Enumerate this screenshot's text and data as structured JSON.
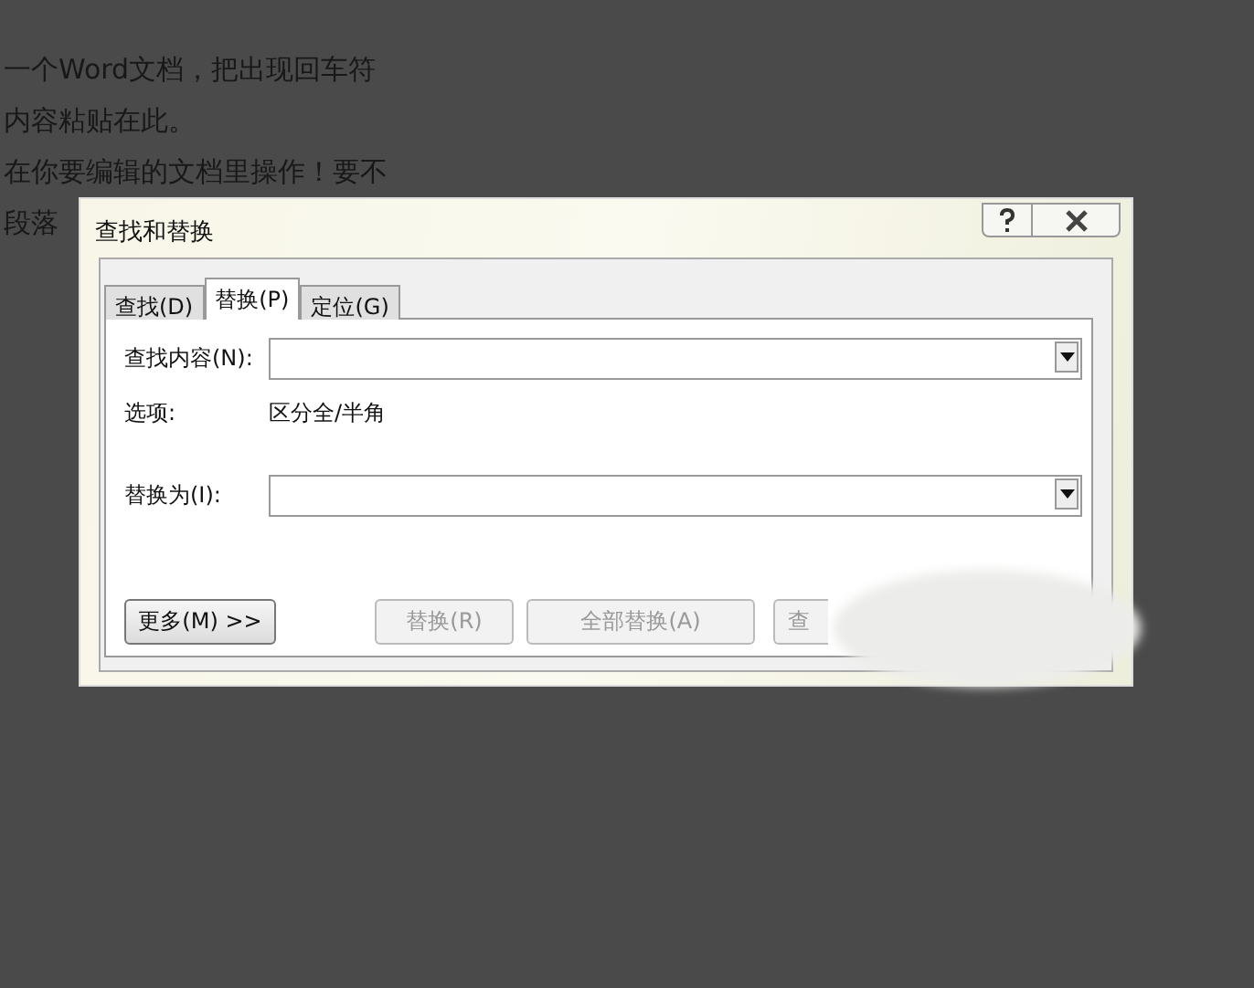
{
  "background_document": {
    "lines": [
      "一个Word文档，把出现回车符",
      "内容粘贴在此。",
      "在你要编辑的文档里操作！要不",
      "段落"
    ]
  },
  "dialog": {
    "title": "查找和替换",
    "tabs": [
      {
        "label": "查找(D)",
        "selected": false
      },
      {
        "label": "替换(P)",
        "selected": true
      },
      {
        "label": "定位(G)",
        "selected": false
      }
    ],
    "find_field": {
      "label": "查找内容(N):"
    },
    "options": {
      "label": "选项:",
      "value": "区分全/半角"
    },
    "replace_field": {
      "label": "替换为(I):"
    },
    "buttons": [
      {
        "label": "更多(M) >>",
        "disabled": false
      },
      {
        "label": "替换(R)",
        "disabled": true
      },
      {
        "label": "全部替换(A)",
        "disabled": true
      },
      {
        "label": "查",
        "disabled": true
      }
    ]
  }
}
